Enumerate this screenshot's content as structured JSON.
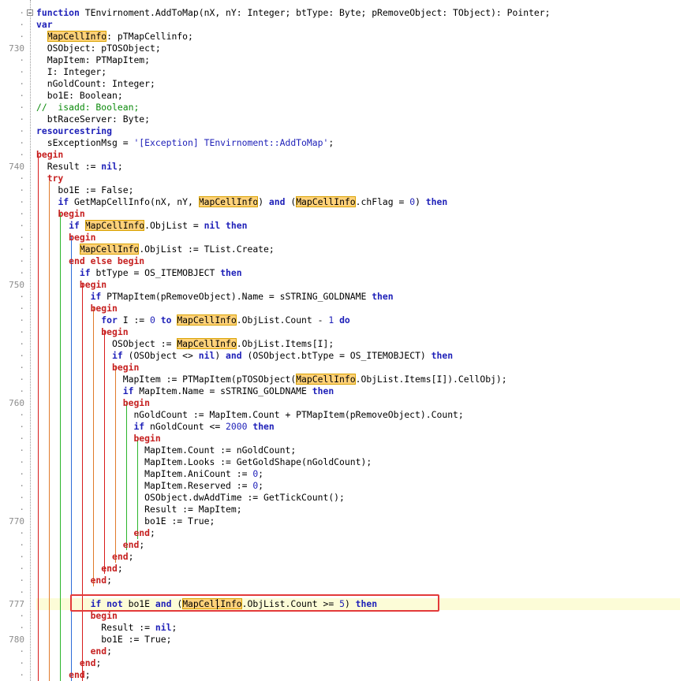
{
  "editor": {
    "gutter_numbers": {
      "g730": "730",
      "g740": "740",
      "g750": "750",
      "g760": "760",
      "g770": "770",
      "g777": "777",
      "g780": "780"
    },
    "colors": {
      "keyword": "#1d1fb8",
      "begin_keyword": "#c61f1f",
      "comment": "#0b8a0b",
      "highlight": "#ffd27a",
      "selection_box": "#e33a3a",
      "current_line": "#fcfcd7"
    },
    "lines": [
      [
        [
          "function",
          "kw"
        ],
        [
          " TEnvirnoment.AddToMap(nX, nY: Integer; btType: Byte; pRemoveObject: TObject): Pointer;",
          ""
        ]
      ],
      [
        [
          "var",
          "kw"
        ]
      ],
      [
        [
          "  ",
          ""
        ],
        [
          "MapCellInfo",
          "hl"
        ],
        [
          ": pTMapCellinfo;",
          ""
        ]
      ],
      [
        [
          "  OSObject: pTOSObject;",
          ""
        ]
      ],
      [
        [
          "  MapItem: PTMapItem;",
          ""
        ]
      ],
      [
        [
          "  I: Integer;",
          ""
        ]
      ],
      [
        [
          "  nGoldCount: Integer;",
          ""
        ]
      ],
      [
        [
          "  bo1E: Boolean;",
          ""
        ]
      ],
      [
        [
          "//  isadd: Boolean;",
          "cm"
        ]
      ],
      [
        [
          "  btRaceServer: Byte;",
          ""
        ]
      ],
      [
        [
          "resourcestring",
          "kw"
        ]
      ],
      [
        [
          "  sExceptionMsg = ",
          ""
        ],
        [
          "'[Exception] TEnvirnoment::AddToMap'",
          "str"
        ],
        [
          ";",
          ""
        ]
      ],
      [
        [
          "begin",
          "kwb"
        ]
      ],
      [
        [
          "  Result := ",
          ""
        ],
        [
          "nil",
          "kw"
        ],
        [
          ";",
          ""
        ]
      ],
      [
        [
          "  ",
          ""
        ],
        [
          "try",
          "kwb"
        ]
      ],
      [
        [
          "    bo1E := False;",
          ""
        ]
      ],
      [
        [
          "    ",
          ""
        ],
        [
          "if",
          "kw"
        ],
        [
          " GetMapCellInfo(nX, nY, ",
          ""
        ],
        [
          "MapCellInfo",
          "hl"
        ],
        [
          ") ",
          ""
        ],
        [
          "and",
          "kw"
        ],
        [
          " (",
          ""
        ],
        [
          "MapCellInfo",
          "hl"
        ],
        [
          ".chFlag = ",
          ""
        ],
        [
          "0",
          "num"
        ],
        [
          ") ",
          ""
        ],
        [
          "then",
          "kw"
        ]
      ],
      [
        [
          "    ",
          ""
        ],
        [
          "begin",
          "kwb"
        ]
      ],
      [
        [
          "      ",
          ""
        ],
        [
          "if",
          "kw"
        ],
        [
          " ",
          ""
        ],
        [
          "MapCellInfo",
          "hl"
        ],
        [
          ".ObjList = ",
          ""
        ],
        [
          "nil",
          "kw"
        ],
        [
          " ",
          ""
        ],
        [
          "then",
          "kw"
        ]
      ],
      [
        [
          "      ",
          ""
        ],
        [
          "begin",
          "kwb"
        ]
      ],
      [
        [
          "        ",
          ""
        ],
        [
          "MapCellInfo",
          "hl"
        ],
        [
          ".ObjList := TList.Create;",
          ""
        ]
      ],
      [
        [
          "      ",
          ""
        ],
        [
          "end else begin",
          "kwb"
        ]
      ],
      [
        [
          "        ",
          ""
        ],
        [
          "if",
          "kw"
        ],
        [
          " btType = OS_ITEMOBJECT ",
          ""
        ],
        [
          "then",
          "kw"
        ]
      ],
      [
        [
          "        ",
          ""
        ],
        [
          "begin",
          "kwb"
        ]
      ],
      [
        [
          "          ",
          ""
        ],
        [
          "if",
          "kw"
        ],
        [
          " PTMapItem(pRemoveObject).Name = sSTRING_GOLDNAME ",
          ""
        ],
        [
          "then",
          "kw"
        ]
      ],
      [
        [
          "          ",
          ""
        ],
        [
          "begin",
          "kwb"
        ]
      ],
      [
        [
          "            ",
          ""
        ],
        [
          "for",
          "kw"
        ],
        [
          " I := ",
          ""
        ],
        [
          "0",
          "num"
        ],
        [
          " ",
          ""
        ],
        [
          "to",
          "kw"
        ],
        [
          " ",
          ""
        ],
        [
          "MapCellInfo",
          "hl"
        ],
        [
          ".ObjList.Count - ",
          ""
        ],
        [
          "1",
          "num"
        ],
        [
          " ",
          ""
        ],
        [
          "do",
          "kw"
        ]
      ],
      [
        [
          "            ",
          ""
        ],
        [
          "begin",
          "kwb"
        ]
      ],
      [
        [
          "              OSObject := ",
          ""
        ],
        [
          "MapCellInfo",
          "hl"
        ],
        [
          ".ObjList.Items[I];",
          ""
        ]
      ],
      [
        [
          "              ",
          ""
        ],
        [
          "if",
          "kw"
        ],
        [
          " (OSObject <> ",
          ""
        ],
        [
          "nil",
          "kw"
        ],
        [
          ") ",
          ""
        ],
        [
          "and",
          "kw"
        ],
        [
          " (OSObject.btType = OS_ITEMOBJECT) ",
          ""
        ],
        [
          "then",
          "kw"
        ]
      ],
      [
        [
          "              ",
          ""
        ],
        [
          "begin",
          "kwb"
        ]
      ],
      [
        [
          "                MapItem := PTMapItem(pTOSObject(",
          ""
        ],
        [
          "MapCellInfo",
          "hl"
        ],
        [
          ".ObjList.Items[I]).CellObj);",
          ""
        ]
      ],
      [
        [
          "                ",
          ""
        ],
        [
          "if",
          "kw"
        ],
        [
          " MapItem.Name = sSTRING_GOLDNAME ",
          ""
        ],
        [
          "then",
          "kw"
        ]
      ],
      [
        [
          "                ",
          ""
        ],
        [
          "begin",
          "kwb"
        ]
      ],
      [
        [
          "                  nGoldCount := MapItem.Count + PTMapItem(pRemoveObject).Count;",
          ""
        ]
      ],
      [
        [
          "                  ",
          ""
        ],
        [
          "if",
          "kw"
        ],
        [
          " nGoldCount <= ",
          ""
        ],
        [
          "2000",
          "num"
        ],
        [
          " ",
          ""
        ],
        [
          "then",
          "kw"
        ]
      ],
      [
        [
          "                  ",
          ""
        ],
        [
          "begin",
          "kwb"
        ]
      ],
      [
        [
          "                    MapItem.Count := nGoldCount;",
          ""
        ]
      ],
      [
        [
          "                    MapItem.Looks := GetGoldShape(nGoldCount);",
          ""
        ]
      ],
      [
        [
          "                    MapItem.AniCount := ",
          ""
        ],
        [
          "0",
          "num"
        ],
        [
          ";",
          ""
        ]
      ],
      [
        [
          "                    MapItem.Reserved := ",
          ""
        ],
        [
          "0",
          "num"
        ],
        [
          ";",
          ""
        ]
      ],
      [
        [
          "                    OSObject.dwAddTime := GetTickCount();",
          ""
        ]
      ],
      [
        [
          "                    Result := MapItem;",
          ""
        ]
      ],
      [
        [
          "                    bo1E := True;",
          ""
        ]
      ],
      [
        [
          "                  ",
          ""
        ],
        [
          "end",
          "kwb"
        ],
        [
          ";",
          ""
        ]
      ],
      [
        [
          "                ",
          ""
        ],
        [
          "end",
          "kwb"
        ],
        [
          ";",
          ""
        ]
      ],
      [
        [
          "              ",
          ""
        ],
        [
          "end",
          "kwb"
        ],
        [
          ";",
          ""
        ]
      ],
      [
        [
          "            ",
          ""
        ],
        [
          "end",
          "kwb"
        ],
        [
          ";",
          ""
        ]
      ],
      [
        [
          "          ",
          ""
        ],
        [
          "end",
          "kwb"
        ],
        [
          ";",
          ""
        ]
      ],
      [
        [
          "",
          ""
        ]
      ],
      [
        [
          "          ",
          ""
        ],
        [
          "if",
          "kw"
        ],
        [
          " ",
          ""
        ],
        [
          "not",
          "kw"
        ],
        [
          " bo1E ",
          ""
        ],
        [
          "and",
          "kw"
        ],
        [
          " (",
          ""
        ],
        [
          "MapCellInfo",
          "hl"
        ],
        [
          ".ObjList.Count >= ",
          ""
        ],
        [
          "5",
          "num"
        ],
        [
          ") ",
          ""
        ],
        [
          "then",
          "kw"
        ]
      ],
      [
        [
          "          ",
          ""
        ],
        [
          "begin",
          "kwb"
        ]
      ],
      [
        [
          "            Result := ",
          ""
        ],
        [
          "nil",
          "kw"
        ],
        [
          ";",
          ""
        ]
      ],
      [
        [
          "            bo1E := True;",
          ""
        ]
      ],
      [
        [
          "          ",
          ""
        ],
        [
          "end",
          "kwb"
        ],
        [
          ";",
          ""
        ]
      ],
      [
        [
          "        ",
          ""
        ],
        [
          "end",
          "kwb"
        ],
        [
          ";",
          ""
        ]
      ],
      [
        [
          "      ",
          ""
        ],
        [
          "end",
          "kwb"
        ],
        [
          ";",
          ""
        ]
      ]
    ]
  }
}
